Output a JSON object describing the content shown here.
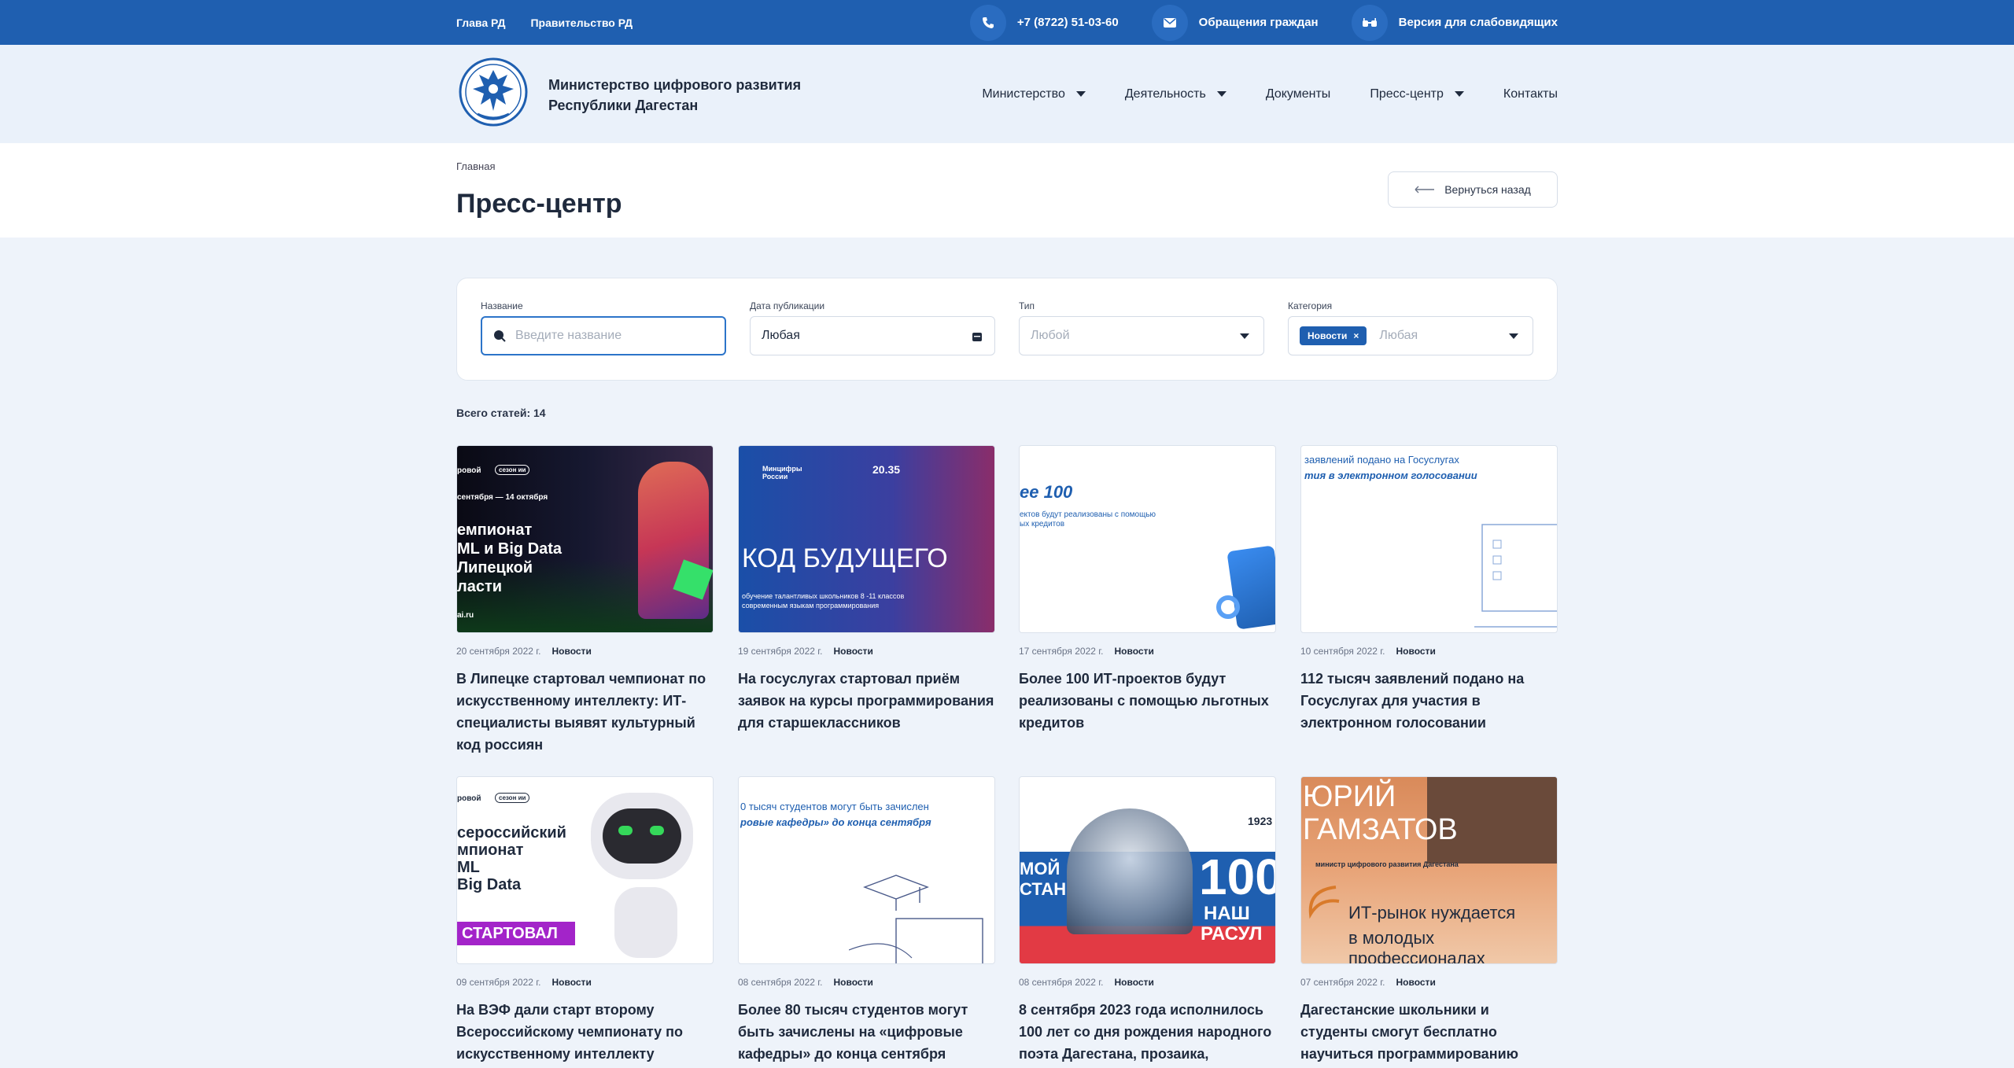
{
  "topbar": {
    "links": [
      "Глава РД",
      "Правительство РД"
    ],
    "phone": "+7 (8722) 51-03-60",
    "appeals": "Обращения граждан",
    "accessibility": "Версия для слабовидящих"
  },
  "header": {
    "org_line1": "Министерство цифрового развития",
    "org_line2": "Республики Дагестан",
    "nav": [
      "Министерство",
      "Деятельность",
      "Документы",
      "Пресс-центр",
      "Контакты"
    ]
  },
  "page": {
    "breadcrumb": "Главная",
    "title": "Пресс-центр",
    "back_label": "Вернуться назад"
  },
  "filters": {
    "name_label": "Название",
    "name_placeholder": "Введите название",
    "date_label": "Дата публикации",
    "date_value": "Любая",
    "type_label": "Тип",
    "type_placeholder": "Любой",
    "category_label": "Категория",
    "category_tag": "Новости",
    "category_placeholder": "Любая"
  },
  "total": "Всего статей: 14",
  "cards": [
    {
      "date": "20 сентября 2022 г.",
      "category": "Новости",
      "title": "В Липецке стартовал чемпионат по искусственному интеллекту: ИТ-специалисты выявят культурный код россиян",
      "img": {
        "l1": "ровой",
        "l2": "сезон ии",
        "l3": "сентября — 14 октября",
        "l4": "емпионат",
        "l5": "ML и Big Data",
        "l6": "Липецкой",
        "l7": "ласти",
        "l8": "ai.ru"
      }
    },
    {
      "date": "19 сентября 2022 г.",
      "category": "Новости",
      "title": "На госуслугах стартовал приём заявок на курсы программирования для старшеклассников",
      "img": {
        "l1": "Минцифры",
        "l2": "России",
        "l3": "20.35",
        "l4": "КОД БУДУЩЕГО",
        "l5": "обучение талантливых школьников 8 -11 классов",
        "l6": "современным языкам программирования"
      }
    },
    {
      "date": "17 сентября 2022 г.",
      "category": "Новости",
      "title": "Более 100 ИТ-проектов будут реализованы с помощью льготных кредитов",
      "img": {
        "l1": "ее 100",
        "l2": "ектов будут реализованы с помощью",
        "l3": "ых кредитов"
      }
    },
    {
      "date": "10 сентября 2022 г.",
      "category": "Новости",
      "title": "112 тысяч заявлений подано на Госуслугах для участия в электронном голосовании",
      "img": {
        "l1": "заявлений подано на Госуслугах",
        "l2": "тия в электронном голосовании"
      }
    },
    {
      "date": "09 сентября 2022 г.",
      "category": "Новости",
      "title": "На ВЭФ дали старт второму Всероссийскому чемпионату по искусственному интеллекту",
      "img": {
        "l1": "ровой",
        "l2": "сезон ии",
        "l3": "сероссийский",
        "l4": "мпионат",
        "l5": "ML",
        "l6": "Big Data",
        "l7": "СТАРТОВАЛ"
      }
    },
    {
      "date": "08 сентября 2022 г.",
      "category": "Новости",
      "title": "Более 80 тысяч студентов могут быть зачислены на «цифровые кафедры» до конца сентября",
      "img": {
        "l1": "0 тысяч студентов могут быть зачислен",
        "l2": "ровые кафедры» до конца сентября"
      }
    },
    {
      "date": "08 сентября 2022 г.",
      "category": "Новости",
      "title": "8 сентября 2023 года исполнилось 100 лет со дня рождения народного поэта Дагестана, прозаика,",
      "img": {
        "l1": "МОЙ",
        "l2": "СТАН",
        "l3": "1923",
        "l4": "100",
        "l5": "НАШ",
        "l6": "РАСУЛ"
      }
    },
    {
      "date": "07 сентября 2022 г.",
      "category": "Новости",
      "title": "Дагестанские школьники и студенты смогут бесплатно научиться программированию",
      "img": {
        "l1": "ЮРИЙ",
        "l2": "ГАМЗАТОВ",
        "l3": "министр цифрового развития Дагестана",
        "l4": "ИТ-рынок нуждается",
        "l5": "в молодых профессионалах"
      }
    }
  ]
}
